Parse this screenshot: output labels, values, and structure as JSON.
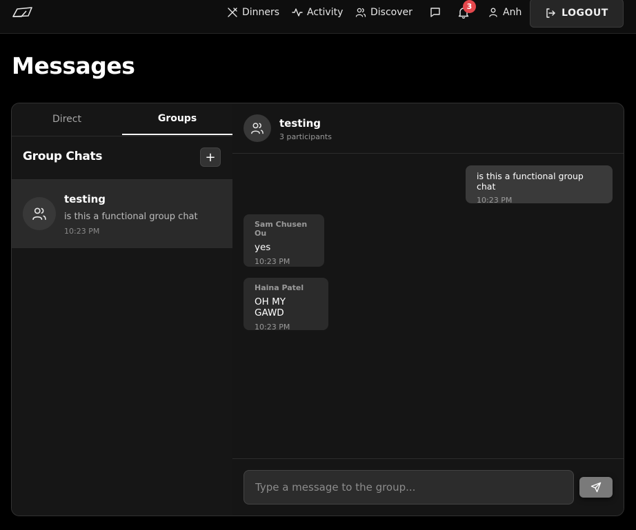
{
  "nav": {
    "dinners_label": "Dinners",
    "activity_label": "Activity",
    "discover_label": "Discover",
    "notification_count": "3",
    "user_name": "Anh",
    "logout_label": "LOGOUT",
    "logo_icon": "tent-logo-icon"
  },
  "page": {
    "title": "Messages"
  },
  "sidebar": {
    "tabs": [
      {
        "label": "Direct",
        "active": false
      },
      {
        "label": "Groups",
        "active": true
      }
    ],
    "section_title": "Group Chats",
    "add_label": "+",
    "conversations": [
      {
        "name": "testing",
        "preview": "is this a functional group chat",
        "time": "10:23 PM",
        "icon": "users-icon"
      }
    ]
  },
  "chat": {
    "title": "testing",
    "subtitle": "3 participants",
    "messages": [
      {
        "mine": true,
        "sender": "",
        "text": "is this a functional group chat",
        "time": "10:23 PM"
      },
      {
        "mine": false,
        "sender": "Sam Chusen Ou",
        "text": "yes",
        "time": "10:23 PM"
      },
      {
        "mine": false,
        "sender": "Haina Patel",
        "text": "OH MY GAWD",
        "time": "10:23 PM"
      }
    ],
    "input_placeholder": "Type a message to the group...",
    "send_icon": "send-icon"
  },
  "colors": {
    "background": "#000000",
    "card": "#151515",
    "badge": "#e5484d",
    "active_item": "#2a2a2a"
  }
}
